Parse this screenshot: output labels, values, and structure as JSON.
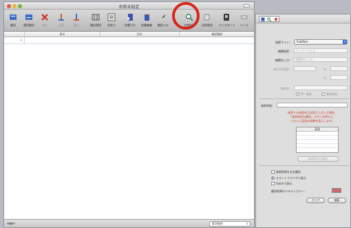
{
  "main_window": {
    "title": "名称未設定",
    "toolbar": [
      {
        "label": "翻訳",
        "icon": "translate-icon",
        "enabled": true
      },
      {
        "label": "選択翻訳",
        "icon": "translate-selection-icon",
        "enabled": true
      },
      {
        "label": "中止",
        "icon": "stop-icon",
        "enabled": false
      },
      {
        "label": "日英",
        "icon": "direction-icon",
        "enabled": false
      },
      {
        "label": "英日",
        "icon": "direction-icon",
        "enabled": false
      },
      {
        "label": "翻訳環境",
        "icon": "environment-icon",
        "enabled": true
      },
      {
        "label": "訳振り",
        "icon": "interlinear-icon",
        "enabled": true
      },
      {
        "label": "辞書引き",
        "icon": "dictionary-icon",
        "enabled": true
      },
      {
        "label": "辞書編集",
        "icon": "dictionary-edit-icon",
        "enabled": true
      },
      {
        "label": "翻訳メモ",
        "icon": "memo-icon",
        "enabled": true
      },
      {
        "label": "文献検索",
        "icon": "literature-search-icon",
        "enabled": true
      },
      {
        "label": "用例検索",
        "icon": "example-search-icon",
        "enabled": true
      },
      {
        "label": "アシスタント",
        "icon": "assistant-icon",
        "enabled": true
      },
      {
        "label": "ツール",
        "icon": "tools-icon",
        "enabled": true
      }
    ],
    "columns": [
      "原文",
      "訳文",
      "確認翻訳"
    ],
    "first_row_number": "1",
    "status_text": "待機中",
    "field_select": "医学総合"
  },
  "side_panel": {
    "search_site_label": "検索サイト：",
    "search_site_value": "PubMed",
    "org_search_label": "機関検索：",
    "org_search_value": "キーワード入力",
    "org_input_label": "機関名入力：",
    "org_input_placeholder": "機関名を入力",
    "year_label": "発行年(西暦)：",
    "year_from_suffix": "年",
    "year_to_suffix": "年",
    "volume_suffix": "号",
    "author_label": "著者名：",
    "first_author_label": "第一著者",
    "last_author_label": "最終著者",
    "search_term_label": "検索単語：",
    "note_lines": [
      "検索する単語を日本語で入力した場合、",
      "「検索単語を翻訳」ボタンを押すと、",
      "リストに英語の候補を表示します。"
    ],
    "list_header": "英語",
    "translate_button": "検索単語を翻訳",
    "full_translate_label": "検索結果を全文翻訳",
    "smart_browser_label": "スマートブラウザで表示",
    "safari_label": "Safariで表示",
    "text_color_label": "翻訳結果のテキストカラー：",
    "clear_button": "クリア",
    "search_button": "検索",
    "colors": {
      "swatch": "#c76b6b",
      "accent": "#3d6fd6",
      "note": "#d23a2a",
      "highlight": "#d8251c"
    }
  }
}
